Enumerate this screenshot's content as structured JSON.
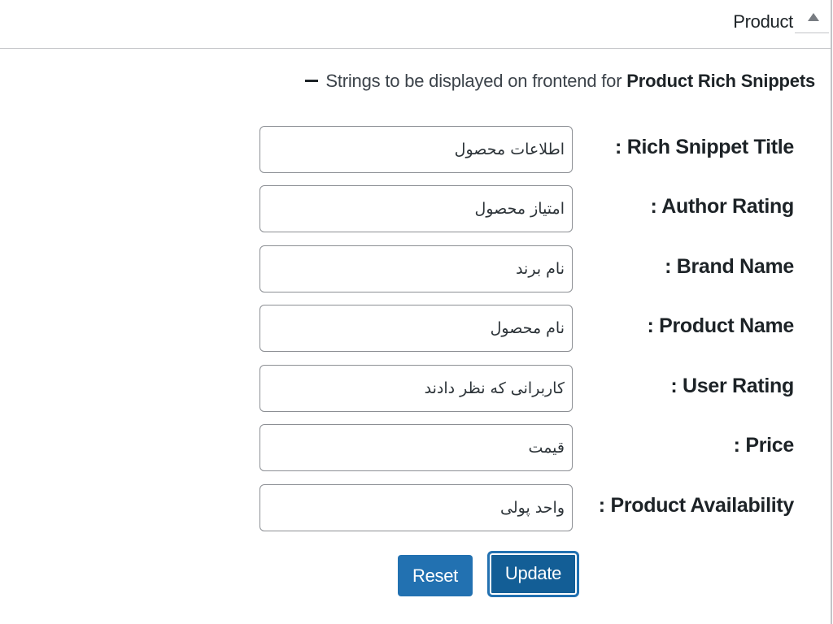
{
  "header": {
    "title": "Product",
    "toggle_icon": "triangle-up-icon"
  },
  "description": {
    "prefix": "Strings to be displayed on frontend for",
    "emphasis": "Product Rich Snippets",
    "icon": "dash-icon"
  },
  "fields": [
    {
      "label": ": Rich Snippet Title",
      "value": "اطلاعات محصول"
    },
    {
      "label": ": Author Rating",
      "value": "امتیاز محصول"
    },
    {
      "label": ": Brand Name",
      "value": "نام برند"
    },
    {
      "label": ": Product Name",
      "value": "نام محصول"
    },
    {
      "label": ": User Rating",
      "value": "کاربرانی که نظر دادند"
    },
    {
      "label": ": Price",
      "value": "قیمت"
    },
    {
      "label": ": Product Availability",
      "value": "واحد پولی"
    }
  ],
  "buttons": {
    "reset": "Reset",
    "update": "Update"
  },
  "colors": {
    "primary": "#2271b1",
    "primary_dark": "#135e96",
    "border": "#8c8f94"
  }
}
